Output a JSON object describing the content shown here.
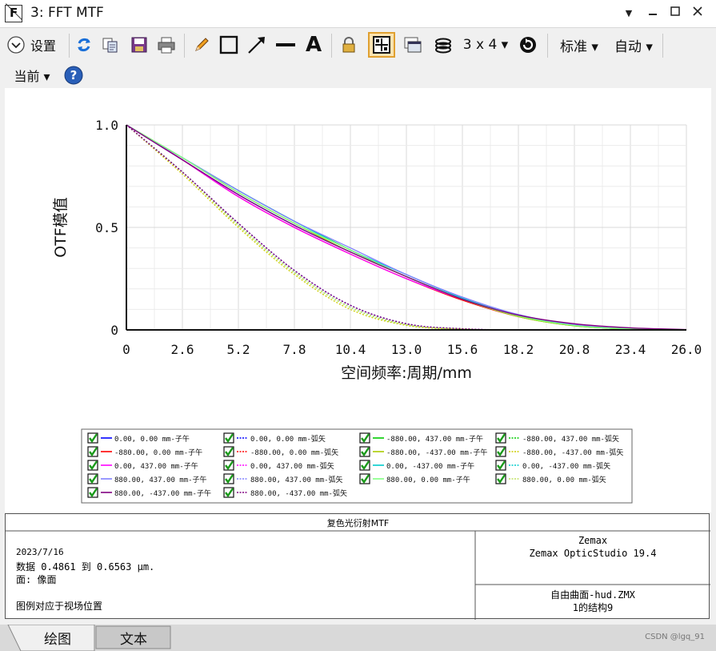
{
  "window": {
    "title": "3: FFT MTF",
    "min_symbol": "▁",
    "max_symbol": "☐",
    "close_symbol": "✕",
    "menu_symbol": "▼"
  },
  "toolbar": {
    "settings_label": "设置",
    "grid_label": "3 x 4 ▾",
    "standard_label": "标准 ▾",
    "auto_label": "自动 ▾",
    "current_label": "当前 ▾",
    "text_tool": "A"
  },
  "chart_data": {
    "type": "line",
    "xlabel": "空间频率:周期/mm",
    "ylabel": "OTF模值",
    "xlim": [
      0,
      26.0
    ],
    "ylim": [
      0,
      1.0
    ],
    "xticks": [
      "0",
      "2.6",
      "5.2",
      "7.8",
      "10.4",
      "13.0",
      "15.6",
      "18.2",
      "20.8",
      "23.4",
      "26.0"
    ],
    "yticks": [
      "0",
      "0.5",
      "1.0"
    ],
    "grid": true,
    "x": [
      0,
      2.6,
      5.2,
      7.8,
      10.4,
      13.0,
      15.6,
      18.2,
      20.8,
      23.4,
      26.0
    ],
    "series": [
      {
        "name": "0.00, 0.00 mm-子午",
        "color": "#0000ff",
        "dash": false,
        "values": [
          1.0,
          0.83,
          0.66,
          0.51,
          0.38,
          0.26,
          0.15,
          0.07,
          0.025,
          0.006,
          0.0
        ]
      },
      {
        "name": "0.00, 0.00 mm-弧矢",
        "color": "#0000ff",
        "dash": true,
        "values": [
          1.0,
          0.77,
          0.52,
          0.29,
          0.12,
          0.03,
          0.005,
          0.0,
          0.0,
          0.0,
          0.0
        ]
      },
      {
        "name": "-880.00, 437.00 mm-子午",
        "color": "#00cc00",
        "dash": false,
        "values": [
          1.0,
          0.84,
          0.68,
          0.53,
          0.39,
          0.26,
          0.15,
          0.065,
          0.02,
          0.004,
          0.0
        ]
      },
      {
        "name": "-880.00, 437.00 mm-弧矢",
        "color": "#00cc00",
        "dash": true,
        "values": [
          1.0,
          0.77,
          0.51,
          0.28,
          0.11,
          0.025,
          0.004,
          0.0,
          0.0,
          0.0,
          0.0
        ]
      },
      {
        "name": "-880.00, 0.00 mm-子午",
        "color": "#ff0000",
        "dash": false,
        "values": [
          1.0,
          0.83,
          0.65,
          0.5,
          0.37,
          0.25,
          0.145,
          0.065,
          0.022,
          0.005,
          0.0
        ]
      },
      {
        "name": "-880.00, 0.00 mm-弧矢",
        "color": "#ff0000",
        "dash": true,
        "values": [
          1.0,
          0.77,
          0.52,
          0.29,
          0.12,
          0.03,
          0.005,
          0.0,
          0.0,
          0.0,
          0.0
        ]
      },
      {
        "name": "-880.00, -437.00 mm-子午",
        "color": "#aacc00",
        "dash": false,
        "values": [
          1.0,
          0.84,
          0.67,
          0.52,
          0.38,
          0.26,
          0.15,
          0.065,
          0.02,
          0.004,
          0.0
        ]
      },
      {
        "name": "-880.00, -437.00 mm-弧矢",
        "color": "#cccc00",
        "dash": true,
        "values": [
          1.0,
          0.76,
          0.5,
          0.27,
          0.1,
          0.022,
          0.003,
          0.0,
          0.0,
          0.0,
          0.0
        ]
      },
      {
        "name": "0.00, 437.00 mm-子午",
        "color": "#ff00ff",
        "dash": false,
        "values": [
          1.0,
          0.83,
          0.65,
          0.5,
          0.37,
          0.25,
          0.15,
          0.07,
          0.028,
          0.008,
          0.001
        ]
      },
      {
        "name": "0.00, 437.00 mm-弧矢",
        "color": "#ff00ff",
        "dash": true,
        "values": [
          1.0,
          0.77,
          0.52,
          0.29,
          0.12,
          0.03,
          0.005,
          0.0,
          0.0,
          0.0,
          0.0
        ]
      },
      {
        "name": "0.00, -437.00 mm-子午",
        "color": "#00cccc",
        "dash": false,
        "values": [
          1.0,
          0.84,
          0.68,
          0.53,
          0.39,
          0.27,
          0.155,
          0.07,
          0.022,
          0.005,
          0.0
        ]
      },
      {
        "name": "0.00, -437.00 mm-弧矢",
        "color": "#00cccc",
        "dash": true,
        "values": [
          1.0,
          0.77,
          0.52,
          0.29,
          0.12,
          0.03,
          0.005,
          0.0,
          0.0,
          0.0,
          0.0
        ]
      },
      {
        "name": "880.00, 437.00 mm-子午",
        "color": "#8080ff",
        "dash": false,
        "values": [
          1.0,
          0.84,
          0.68,
          0.53,
          0.4,
          0.27,
          0.16,
          0.075,
          0.025,
          0.006,
          0.0
        ]
      },
      {
        "name": "880.00, 437.00 mm-弧矢",
        "color": "#8080ff",
        "dash": true,
        "values": [
          1.0,
          0.77,
          0.52,
          0.29,
          0.12,
          0.03,
          0.005,
          0.0,
          0.0,
          0.0,
          0.0
        ]
      },
      {
        "name": "880.00, 0.00 mm-子午",
        "color": "#80ff80",
        "dash": false,
        "values": [
          1.0,
          0.84,
          0.67,
          0.52,
          0.39,
          0.26,
          0.15,
          0.068,
          0.022,
          0.005,
          0.0
        ]
      },
      {
        "name": "880.00, 0.00 mm-弧矢",
        "color": "#c0e060",
        "dash": true,
        "values": [
          1.0,
          0.77,
          0.51,
          0.28,
          0.11,
          0.026,
          0.004,
          0.0,
          0.0,
          0.0,
          0.0
        ]
      },
      {
        "name": "880.00, -437.00 mm-子午",
        "color": "#800080",
        "dash": false,
        "values": [
          1.0,
          0.83,
          0.66,
          0.51,
          0.38,
          0.26,
          0.15,
          0.072,
          0.03,
          0.01,
          0.002
        ]
      },
      {
        "name": "880.00, -437.00 mm-弧矢",
        "color": "#800080",
        "dash": true,
        "values": [
          1.0,
          0.77,
          0.52,
          0.29,
          0.12,
          0.03,
          0.006,
          0.0,
          0.0,
          0.0,
          0.0
        ]
      }
    ]
  },
  "info": {
    "title": "复色光衍射MTF",
    "date": "2023/7/16",
    "data_line": "数据 0.4861 到 0.6563 μm.",
    "surface_line": "面: 像面",
    "legend_note": "图例对应于视场位置",
    "company": "Zemax",
    "product": "Zemax OpticStudio 19.4",
    "file": "自由曲面-hud.ZMX",
    "config": "1的结构9"
  },
  "tabs": {
    "graph": "绘图",
    "text": "文本"
  },
  "watermark": "CSDN @lgq_91"
}
